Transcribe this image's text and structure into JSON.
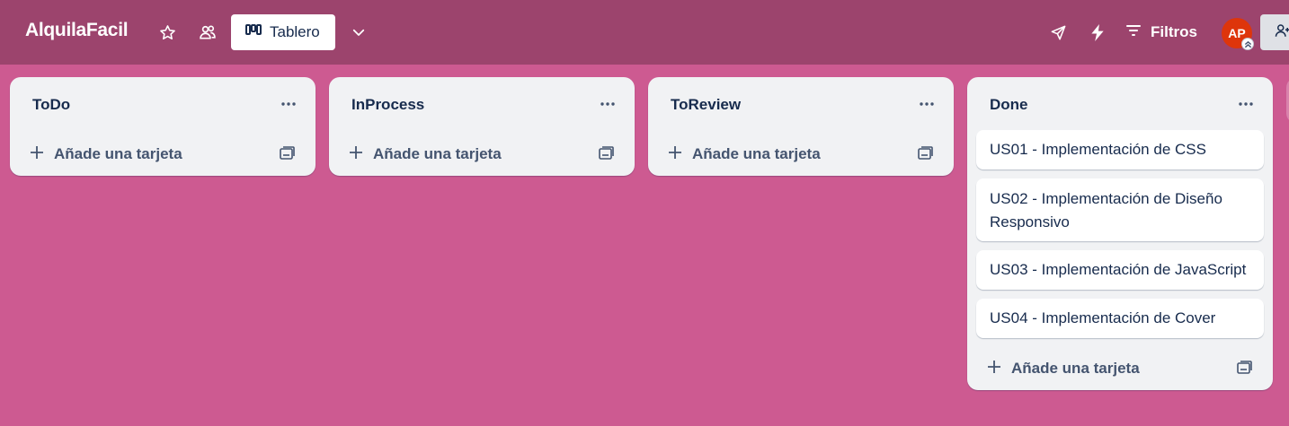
{
  "board": {
    "title": "AlquilaFacil",
    "view_label": "Tablero",
    "filters_label": "Filtros",
    "avatar_initials": "AP"
  },
  "colors": {
    "background": "#cd5a91",
    "header": "#9c446d",
    "list": "#f1f2f4",
    "avatar": "#de350b"
  },
  "icons": {
    "star": "star-icon",
    "visibility": "workspace-visible-icon",
    "board_view": "board-view-icon",
    "dropdown": "chevron-down-icon",
    "power_ups": "rocket-icon",
    "automation": "lightning-icon",
    "filter": "filter-icon",
    "share": "add-member-icon",
    "list_menu": "more-icon",
    "add": "plus-icon",
    "template": "card-template-icon"
  },
  "add_card_label": "Añade una tarjeta",
  "lists": [
    {
      "title": "ToDo",
      "cards": []
    },
    {
      "title": "InProcess",
      "cards": []
    },
    {
      "title": "ToReview",
      "cards": []
    },
    {
      "title": "Done",
      "cards": [
        "US01 - Implementación de CSS",
        "US02 - Implementación de Diseño Responsivo",
        "US03 - Implementación de JavaScript",
        "US04 - Implementación de Cover"
      ]
    }
  ]
}
